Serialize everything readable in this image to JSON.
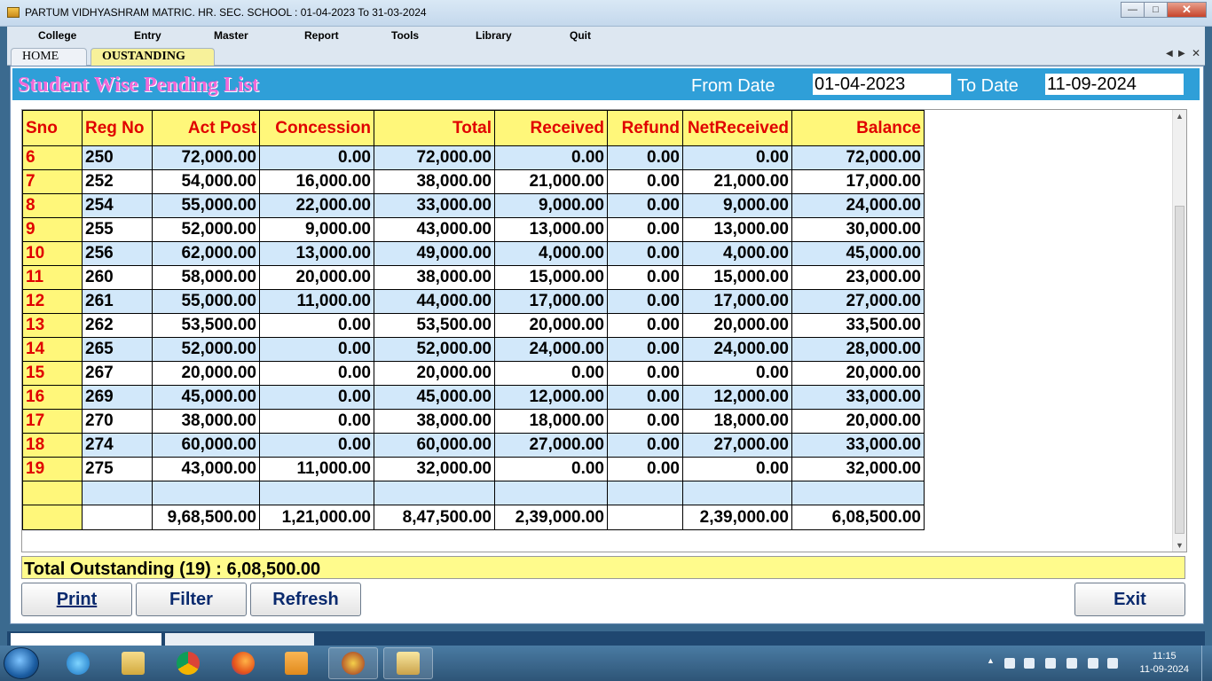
{
  "window": {
    "title": "PARTUM VIDHYASHRAM MATRIC. HR. SEC. SCHOOL  :  01-04-2023 To 31-03-2024"
  },
  "menu": [
    {
      "label": "College"
    },
    {
      "label": "Entry"
    },
    {
      "label": "Master"
    },
    {
      "label": "Report"
    },
    {
      "label": "Tools"
    },
    {
      "label": "Library"
    },
    {
      "label": "Quit"
    }
  ],
  "tabs": {
    "home": "HOME",
    "active": "OUSTANDING"
  },
  "header": {
    "heading": "Student Wise Pending List",
    "from_label": "From Date",
    "from_value": "01-04-2023",
    "to_label": "To Date",
    "to_value": "11-09-2024"
  },
  "table": {
    "columns": [
      "Sno",
      "Reg No",
      "Act Post",
      "Concession",
      "Total",
      "Received",
      "Refund",
      "NetReceived",
      "Balance"
    ],
    "rows": [
      [
        "6",
        "250",
        "72,000.00",
        "0.00",
        "72,000.00",
        "0.00",
        "0.00",
        "0.00",
        "72,000.00"
      ],
      [
        "7",
        "252",
        "54,000.00",
        "16,000.00",
        "38,000.00",
        "21,000.00",
        "0.00",
        "21,000.00",
        "17,000.00"
      ],
      [
        "8",
        "254",
        "55,000.00",
        "22,000.00",
        "33,000.00",
        "9,000.00",
        "0.00",
        "9,000.00",
        "24,000.00"
      ],
      [
        "9",
        "255",
        "52,000.00",
        "9,000.00",
        "43,000.00",
        "13,000.00",
        "0.00",
        "13,000.00",
        "30,000.00"
      ],
      [
        "10",
        "256",
        "62,000.00",
        "13,000.00",
        "49,000.00",
        "4,000.00",
        "0.00",
        "4,000.00",
        "45,000.00"
      ],
      [
        "11",
        "260",
        "58,000.00",
        "20,000.00",
        "38,000.00",
        "15,000.00",
        "0.00",
        "15,000.00",
        "23,000.00"
      ],
      [
        "12",
        "261",
        "55,000.00",
        "11,000.00",
        "44,000.00",
        "17,000.00",
        "0.00",
        "17,000.00",
        "27,000.00"
      ],
      [
        "13",
        "262",
        "53,500.00",
        "0.00",
        "53,500.00",
        "20,000.00",
        "0.00",
        "20,000.00",
        "33,500.00"
      ],
      [
        "14",
        "265",
        "52,000.00",
        "0.00",
        "52,000.00",
        "24,000.00",
        "0.00",
        "24,000.00",
        "28,000.00"
      ],
      [
        "15",
        "267",
        "20,000.00",
        "0.00",
        "20,000.00",
        "0.00",
        "0.00",
        "0.00",
        "20,000.00"
      ],
      [
        "16",
        "269",
        "45,000.00",
        "0.00",
        "45,000.00",
        "12,000.00",
        "0.00",
        "12,000.00",
        "33,000.00"
      ],
      [
        "17",
        "270",
        "38,000.00",
        "0.00",
        "38,000.00",
        "18,000.00",
        "0.00",
        "18,000.00",
        "20,000.00"
      ],
      [
        "18",
        "274",
        "60,000.00",
        "0.00",
        "60,000.00",
        "27,000.00",
        "0.00",
        "27,000.00",
        "33,000.00"
      ],
      [
        "19",
        "275",
        "43,000.00",
        "11,000.00",
        "32,000.00",
        "0.00",
        "0.00",
        "0.00",
        "32,000.00"
      ]
    ],
    "totals": [
      "",
      "",
      "9,68,500.00",
      "1,21,000.00",
      "8,47,500.00",
      "2,39,000.00",
      "",
      "2,39,000.00",
      "6,08,500.00"
    ]
  },
  "summary": "Total Outstanding (19) : 6,08,500.00",
  "buttons": {
    "print": "Print",
    "filter": "Filter",
    "refresh": "Refresh",
    "exit": "Exit"
  },
  "taskbar": {
    "time": "11:15",
    "date": "11-09-2024",
    "apps": [
      "internet-explorer-icon",
      "file-explorer-icon",
      "chrome-icon",
      "firefox-icon",
      "media-player-icon",
      "app-icon",
      "school-app-icon"
    ]
  }
}
